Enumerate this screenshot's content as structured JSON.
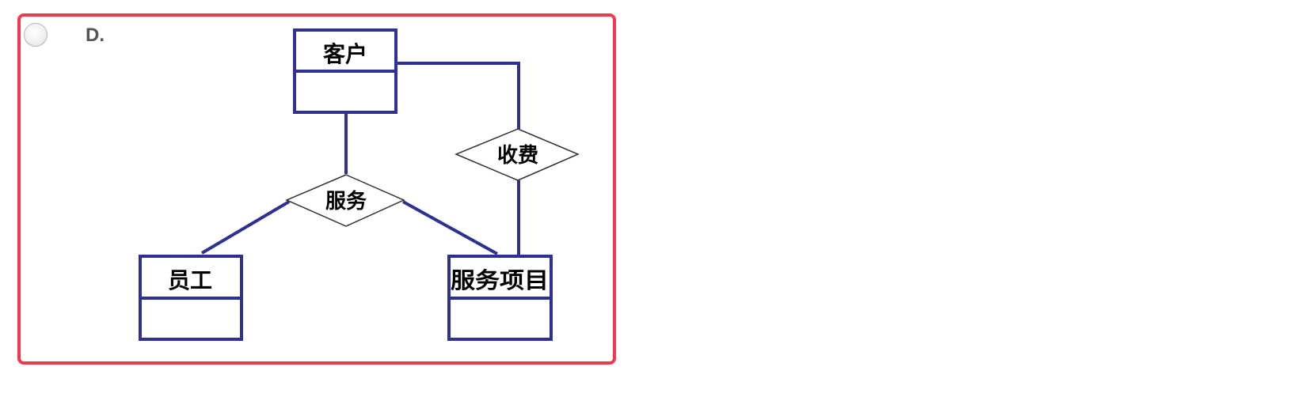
{
  "option": {
    "letter": "D."
  },
  "diagram": {
    "entities": [
      {
        "name": "客户"
      },
      {
        "name": "员工"
      },
      {
        "name": "服务项目"
      }
    ],
    "relationships": [
      {
        "name": "服务"
      },
      {
        "name": "收费"
      }
    ]
  },
  "colors": {
    "card_border": "#f0394d",
    "entity_line": "#2e3192",
    "diamond_line": "#333333"
  }
}
